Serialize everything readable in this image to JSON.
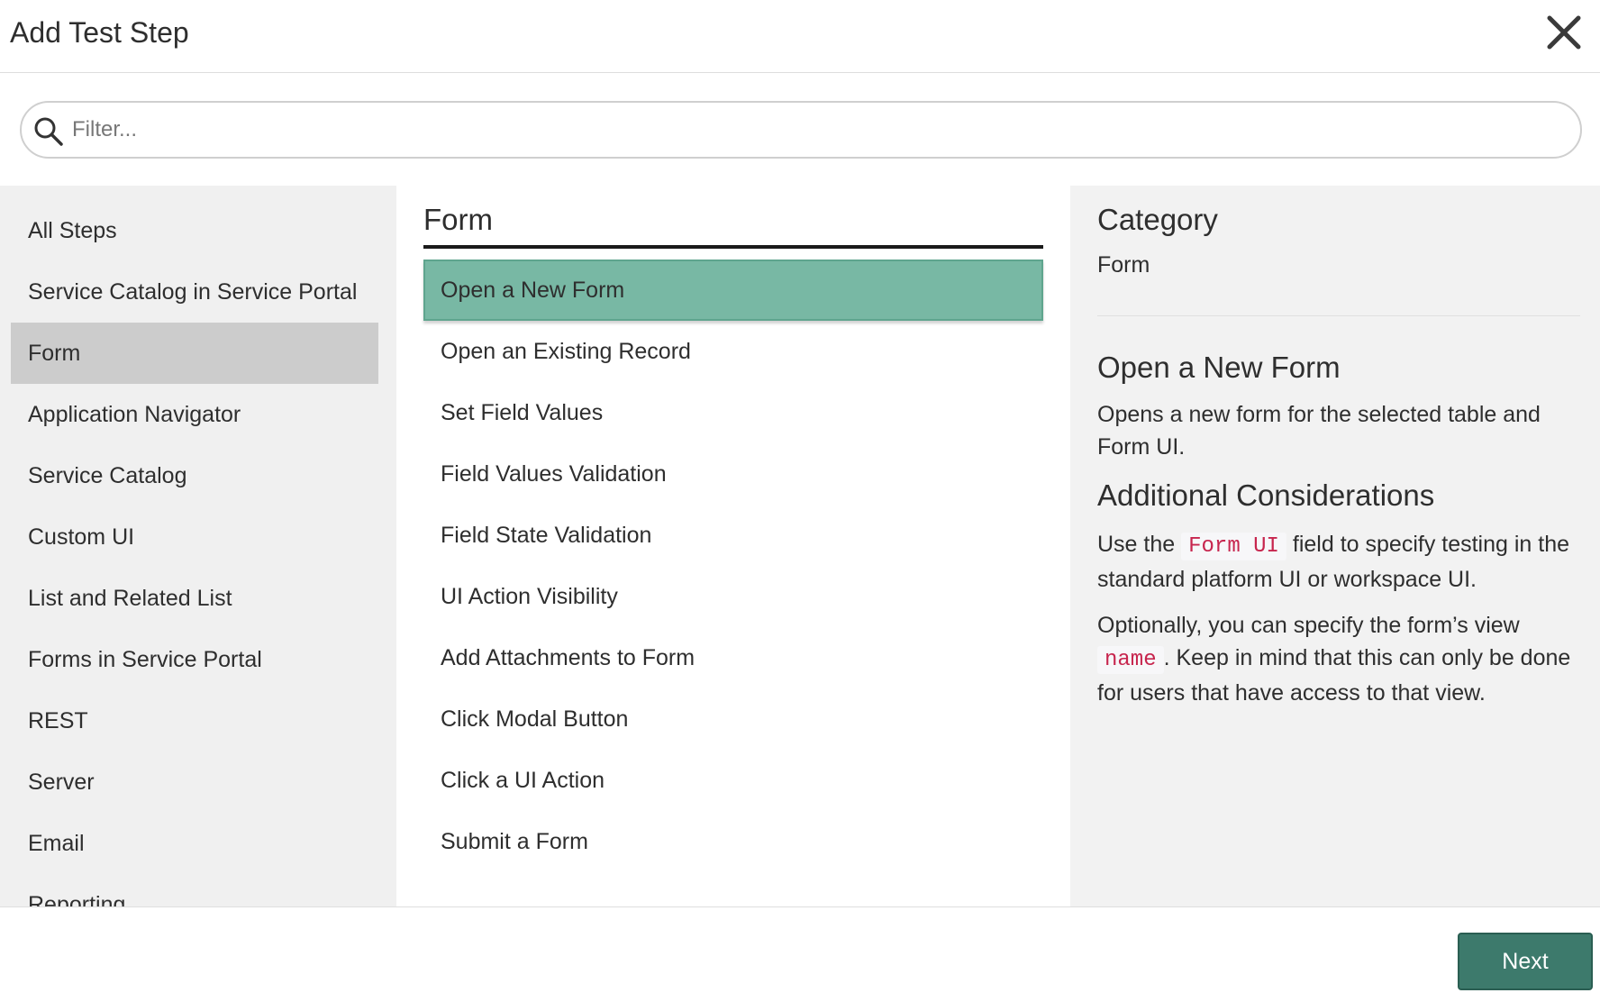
{
  "header": {
    "title": "Add Test Step"
  },
  "search": {
    "placeholder": "Filter..."
  },
  "categories": [
    {
      "label": "All Steps"
    },
    {
      "label": "Service Catalog in Service Portal"
    },
    {
      "label": "Form",
      "selected": true
    },
    {
      "label": "Application Navigator"
    },
    {
      "label": "Service Catalog"
    },
    {
      "label": "Custom UI"
    },
    {
      "label": "List and Related List"
    },
    {
      "label": "Forms in Service Portal"
    },
    {
      "label": "REST"
    },
    {
      "label": "Server"
    },
    {
      "label": "Email"
    },
    {
      "label": "Reporting"
    }
  ],
  "steps": {
    "heading": "Form",
    "items": [
      {
        "label": "Open a New Form",
        "selected": true
      },
      {
        "label": "Open an Existing Record"
      },
      {
        "label": "Set Field Values"
      },
      {
        "label": "Field Values Validation"
      },
      {
        "label": "Field State Validation"
      },
      {
        "label": "UI Action Visibility"
      },
      {
        "label": "Add Attachments to Form"
      },
      {
        "label": "Click Modal Button"
      },
      {
        "label": "Click a UI Action"
      },
      {
        "label": "Submit a Form"
      }
    ]
  },
  "details": {
    "category_label": "Category",
    "category_value": "Form",
    "step_title": "Open a New Form",
    "step_description": "Opens a new form for the selected table and Form UI.",
    "ac_title": "Additional Considerations",
    "ac_p1_prefix": "Use the",
    "ac_p1_code": "Form UI",
    "ac_p1_suffix": "field to specify testing in the standard platform UI or workspace UI.",
    "ac_p2_prefix": "Optionally, you can specify the form’s view",
    "ac_p2_code": "name",
    "ac_p2_suffix": ". Keep in mind that this can only be done for users that have access to that view."
  },
  "footer": {
    "next_label": "Next"
  },
  "colors": {
    "accent": "#3d7a6c",
    "selected_step": "#78b8a4",
    "selected_category": "#cccccc",
    "code_text": "#c7254e"
  }
}
